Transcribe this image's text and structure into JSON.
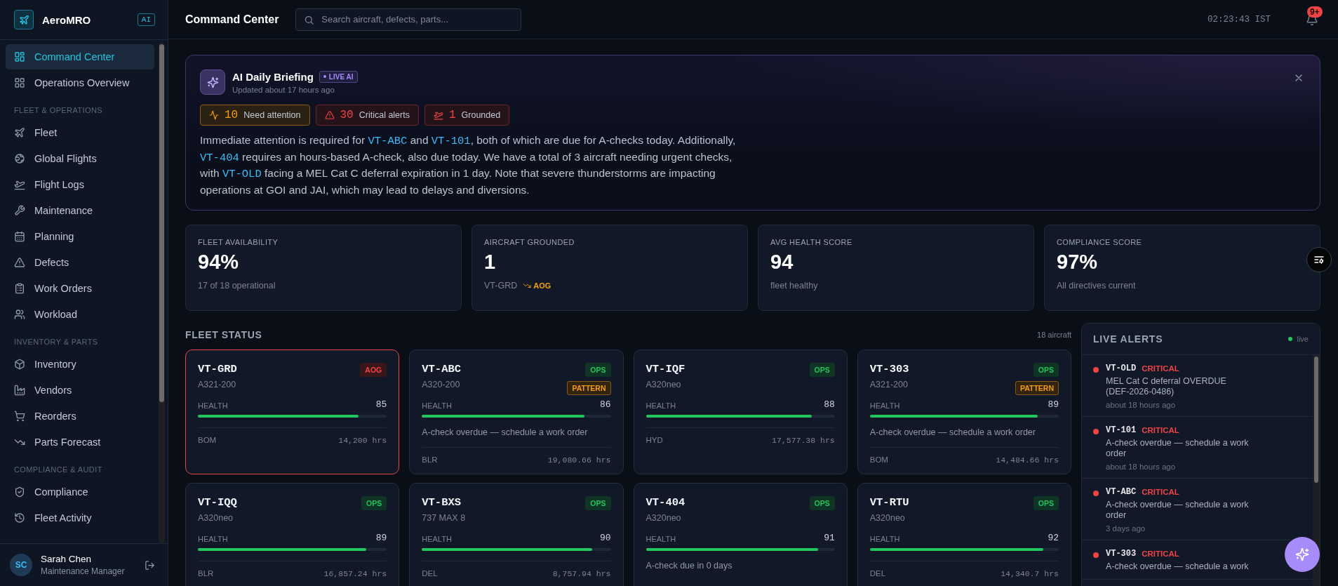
{
  "sidebar": {
    "brand": "AeroMRO",
    "badge": "AI",
    "sections": [
      {
        "items": [
          {
            "label": "Command Center",
            "selected": true
          },
          {
            "label": "Operations Overview",
            "selected": false
          }
        ]
      },
      {
        "heading": "FLEET & OPERATIONS",
        "items": [
          {
            "label": "Fleet",
            "selected": false
          },
          {
            "label": "Global Flights",
            "selected": false
          },
          {
            "label": "Flight Logs",
            "selected": false
          },
          {
            "label": "Maintenance",
            "selected": false
          },
          {
            "label": "Planning",
            "selected": false
          },
          {
            "label": "Defects",
            "selected": false
          },
          {
            "label": "Work Orders",
            "selected": false
          },
          {
            "label": "Workload",
            "selected": false
          }
        ]
      },
      {
        "heading": "INVENTORY & PARTS",
        "items": [
          {
            "label": "Inventory",
            "selected": false
          },
          {
            "label": "Vendors",
            "selected": false
          },
          {
            "label": "Reorders",
            "selected": false
          },
          {
            "label": "Parts Forecast",
            "selected": false
          }
        ]
      },
      {
        "heading": "COMPLIANCE & AUDIT",
        "items": [
          {
            "label": "Compliance",
            "selected": false
          },
          {
            "label": "Fleet Activity",
            "selected": false
          }
        ]
      }
    ],
    "user": {
      "initials": "SC",
      "name": "Sarah Chen",
      "role": "Maintenance Manager"
    }
  },
  "header": {
    "title": "Command Center",
    "search": {
      "placeholder": "Search aircraft, defects, parts..."
    },
    "clock": "02:23:43 IST",
    "notifications": "9+"
  },
  "briefing": {
    "title": "AI Daily Briefing",
    "tag": "LIVE AI",
    "updated": "Updated about 17 hours ago",
    "chips": [
      {
        "kind": "attention",
        "count": "10",
        "label": "Need attention"
      },
      {
        "kind": "critical",
        "count": "30",
        "label": "Critical alerts"
      },
      {
        "kind": "grounded",
        "count": "1",
        "label": "Grounded"
      }
    ],
    "summary": [
      {
        "kind": "text",
        "text": "Immediate attention is required for "
      },
      {
        "kind": "tail",
        "text": "VT-ABC"
      },
      {
        "kind": "text",
        "text": " and "
      },
      {
        "kind": "tail",
        "text": "VT-101"
      },
      {
        "kind": "text",
        "text": ", both of which are due for A-checks today. Additionally, "
      },
      {
        "kind": "tail",
        "text": "VT-404"
      },
      {
        "kind": "text",
        "text": " requires an hours-based A-check, also due today. We have a total of 3 aircraft needing urgent checks, with "
      },
      {
        "kind": "tail",
        "text": "VT-OLD"
      },
      {
        "kind": "text",
        "text": " facing a MEL Cat C deferral expiration in 1 day. Note that severe thunderstorms are impacting operations at GOI and JAI, which may lead to delays and diversions."
      }
    ]
  },
  "stats": [
    {
      "label": "FLEET AVAILABILITY",
      "value": "94%",
      "sub": "17 of 18 operational"
    },
    {
      "label": "AIRCRAFT GROUNDED",
      "value": "1",
      "sub": "VT-GRD",
      "flag": "AOG"
    },
    {
      "label": "AVG HEALTH SCORE",
      "value": "94",
      "sub": "fleet healthy"
    },
    {
      "label": "COMPLIANCE SCORE",
      "value": "97%",
      "sub": "All directives current"
    }
  ],
  "fleet_status": {
    "title": "FLEET STATUS",
    "count": "18 aircraft",
    "aircraft": [
      {
        "tail": "VT-GRD",
        "model": "A321-200",
        "critical": true,
        "badges": [
          {
            "kind": "aog",
            "label": "AOG"
          }
        ],
        "health_label": "HEALTH",
        "health": "85",
        "level": 0.85,
        "base": "BOM",
        "hours": "14,200 hrs"
      },
      {
        "tail": "VT-ABC",
        "model": "A320-200",
        "critical": false,
        "badges": [
          {
            "kind": "ops",
            "label": "OPS"
          },
          {
            "kind": "pattern",
            "label": "PATTERN"
          }
        ],
        "health_label": "HEALTH",
        "health": "86",
        "level": 0.86,
        "note": "A-check overdue — schedule a work order",
        "base": "BLR",
        "hours": "19,080.66 hrs"
      },
      {
        "tail": "VT-IQF",
        "model": "A320neo",
        "critical": false,
        "badges": [
          {
            "kind": "ops",
            "label": "OPS"
          }
        ],
        "health_label": "HEALTH",
        "health": "88",
        "level": 0.88,
        "base": "HYD",
        "hours": "17,577.38 hrs"
      },
      {
        "tail": "VT-303",
        "model": "A321-200",
        "critical": false,
        "badges": [
          {
            "kind": "ops",
            "label": "OPS"
          },
          {
            "kind": "pattern",
            "label": "PATTERN"
          }
        ],
        "health_label": "HEALTH",
        "health": "89",
        "level": 0.89,
        "note": "A-check overdue — schedule a work order",
        "base": "BOM",
        "hours": "14,484.66 hrs"
      },
      {
        "tail": "VT-IQQ",
        "model": "A320neo",
        "critical": false,
        "badges": [
          {
            "kind": "ops",
            "label": "OPS"
          }
        ],
        "health_label": "HEALTH",
        "health": "89",
        "level": 0.89,
        "base": "BLR",
        "hours": "16,857.24 hrs"
      },
      {
        "tail": "VT-BXS",
        "model": "737 MAX 8",
        "critical": false,
        "badges": [
          {
            "kind": "ops",
            "label": "OPS"
          }
        ],
        "health_label": "HEALTH",
        "health": "90",
        "level": 0.9,
        "base": "DEL",
        "hours": "8,757.94 hrs"
      },
      {
        "tail": "VT-404",
        "model": "A320neo",
        "critical": false,
        "badges": [
          {
            "kind": "ops",
            "label": "OPS"
          }
        ],
        "health_label": "HEALTH",
        "health": "91",
        "level": 0.91,
        "note": "A-check due in 0 days"
      },
      {
        "tail": "VT-RTU",
        "model": "A320neo",
        "critical": false,
        "badges": [
          {
            "kind": "ops",
            "label": "OPS"
          }
        ],
        "health_label": "HEALTH",
        "health": "92",
        "level": 0.92,
        "base": "DEL",
        "hours": "14,340.7 hrs"
      }
    ]
  },
  "alerts": {
    "title": "LIVE ALERTS",
    "status": "live",
    "items": [
      {
        "kind": "critical",
        "tail": "VT-OLD",
        "severity": "CRITICAL",
        "message": "MEL Cat C deferral OVERDUE (DEF-2026-0486)",
        "time": "about 18 hours ago"
      },
      {
        "kind": "critical",
        "tail": "VT-101",
        "severity": "CRITICAL",
        "message": "A-check overdue — schedule a work order",
        "time": "about 18 hours ago"
      },
      {
        "kind": "critical",
        "tail": "VT-ABC",
        "severity": "CRITICAL",
        "message": "A-check overdue — schedule a work order",
        "time": "3 days ago"
      },
      {
        "kind": "critical",
        "tail": "VT-303",
        "severity": "CRITICAL",
        "message": "A-check overdue — schedule a work"
      }
    ]
  }
}
